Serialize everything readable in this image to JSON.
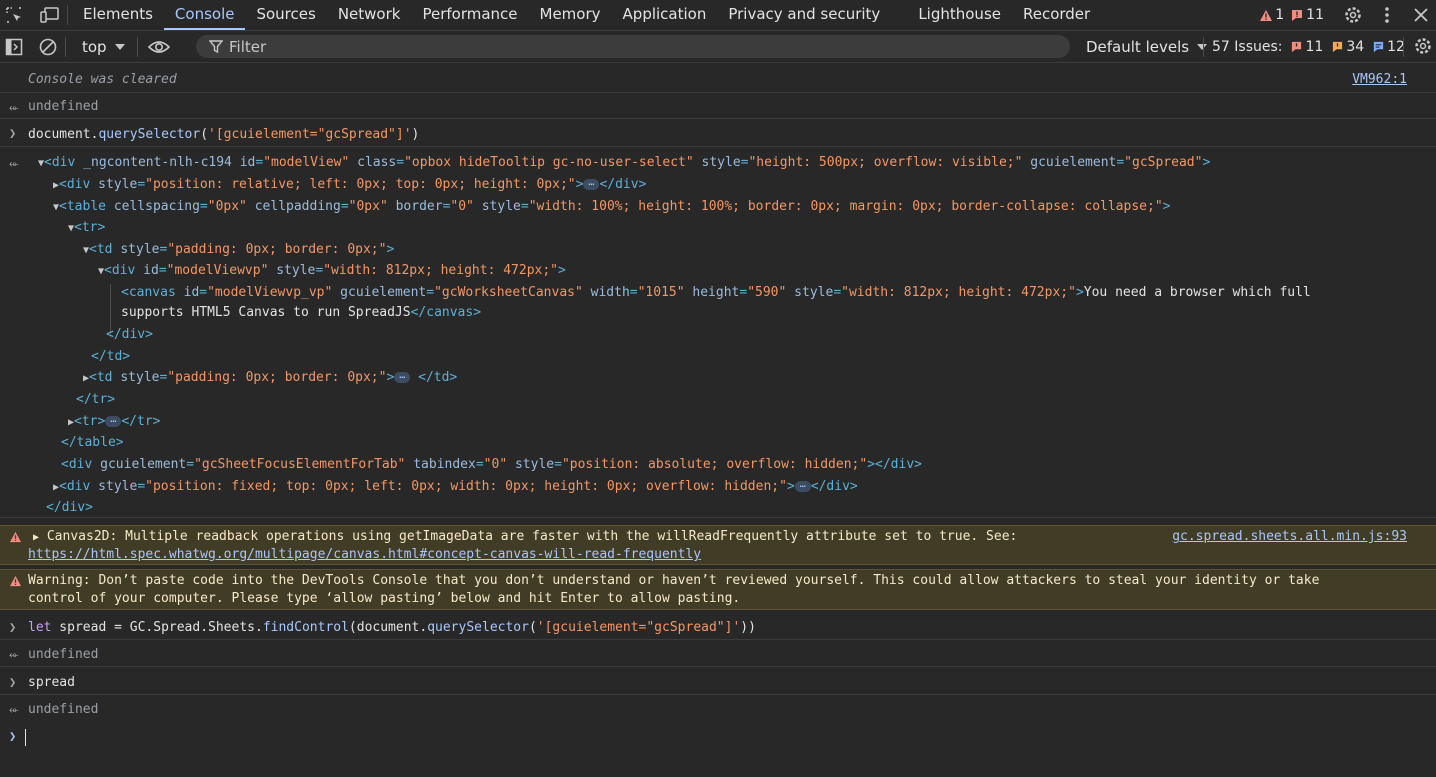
{
  "tabs": [
    "Elements",
    "Console",
    "Sources",
    "Network",
    "Performance",
    "Memory",
    "Application",
    "Privacy and security",
    "Lighthouse",
    "Recorder"
  ],
  "active_tab": "Console",
  "top_counts": {
    "warnings": "1",
    "errors": "11"
  },
  "toolbar": {
    "context": "top",
    "filter_placeholder": "Filter",
    "levels": "Default levels",
    "issues_label": "57 Issues:",
    "issues_errors": "11",
    "issues_warnings": "34",
    "issues_info": "12"
  },
  "console": {
    "cleared": "Console was cleared",
    "cleared_source": "VM962:1",
    "undefined": "undefined",
    "cmd1_a": "document.",
    "cmd1_b": "querySelector",
    "cmd1_c": "(",
    "cmd1_d": "'[gcuielement=\"gcSpread\"]'",
    "cmd1_e": ")",
    "warn1_text": "Canvas2D: Multiple readback operations using getImageData are faster with the willReadFrequently attribute set to true. See:",
    "warn1_link": "https://html.spec.whatwg.org/multipage/canvas.html#concept-canvas-will-read-frequently",
    "warn1_source": "gc.spread.sheets.all.min.js:93",
    "warn2_line1": "Warning: Don’t paste code into the DevTools Console that you don’t understand or haven’t reviewed yourself. This could allow attackers to steal your identity or take",
    "warn2_line2": "control of your computer. Please type ‘allow pasting’ below and hit Enter to allow pasting.",
    "cmd2_kw": "let",
    "cmd2_var": " spread = ",
    "cmd2_path": "GC.Spread.Sheets.",
    "cmd2_fn": "findControl",
    "cmd2_mid": "(document.",
    "cmd2_q": "querySelector",
    "cmd2_open": "(",
    "cmd2_str": "'[gcuielement=\"gcSpread\"]'",
    "cmd2_close": "))",
    "cmd3": "spread"
  },
  "dom": {
    "div_open_1": "<div",
    "div_attr_ng": " _ngcontent-nlh-c194",
    "id_attr": " id",
    "eq": "=",
    "div_id_val": "\"modelView\"",
    "class_attr": " class",
    "class_val": "\"opbox hideTooltip gc-no-user-select\"",
    "style_attr": " style",
    "style_val_1": "\"height: 500px; overflow: visible;\"",
    "gcui_attr": " gcuielement",
    "gcui_val_1": "\"gcSpread\"",
    "gt": ">",
    "div_open": "<div",
    "style_val_2": "\"position: relative; left: 0px; top: 0px; height: 0px;\"",
    "div_close": "</div>",
    "table_open": "<table",
    "cellspacing_attr": " cellspacing",
    "cellspacing_val": "\"0px\"",
    "cellpadding_attr": " cellpadding",
    "cellpadding_val": "\"0px\"",
    "border_attr": " border",
    "border_val": "\"0\"",
    "style_val_table": "\"width: 100%; height: 100%; border: 0px; margin: 0px; border-collapse: collapse;\"",
    "tr_open": "<tr>",
    "td_open": "<td",
    "style_val_td": "\"padding: 0px; border: 0px;\"",
    "vp_id_val": "\"modelViewvp\"",
    "style_val_vp": "\"width: 812px; height: 472px;\"",
    "canvas_open": "<canvas",
    "canvas_id_val": "\"modelViewvp_vp\"",
    "gcui_val_ws": "\"gcWorksheetCanvas\"",
    "width_attr": " width",
    "width_val": "\"1015\"",
    "height_attr": " height",
    "height_val": "\"590\"",
    "canvas_text_1": "You need a browser which full",
    "canvas_text_2": "supports HTML5 Canvas to run SpreadJS",
    "canvas_close": "</canvas>",
    "td_close": "</td>",
    "tr_close": "</tr>",
    "table_close": "</table>",
    "gcui_val_focus": "\"gcSheetFocusElementForTab\"",
    "tabindex_attr": " tabindex",
    "tabindex_val": "\"0\"",
    "style_val_focus": "\"position: absolute; overflow: hidden;\"",
    "style_val_fixed": "\"position: fixed; top: 0px; left: 0px; width: 0px; height: 0px; overflow: hidden;\"",
    "ellipsis": "…"
  },
  "colors": {
    "accent": "#a8c7fa",
    "warning": "#f2c14f",
    "error": "#f28b82",
    "info": "#7cacf8"
  }
}
